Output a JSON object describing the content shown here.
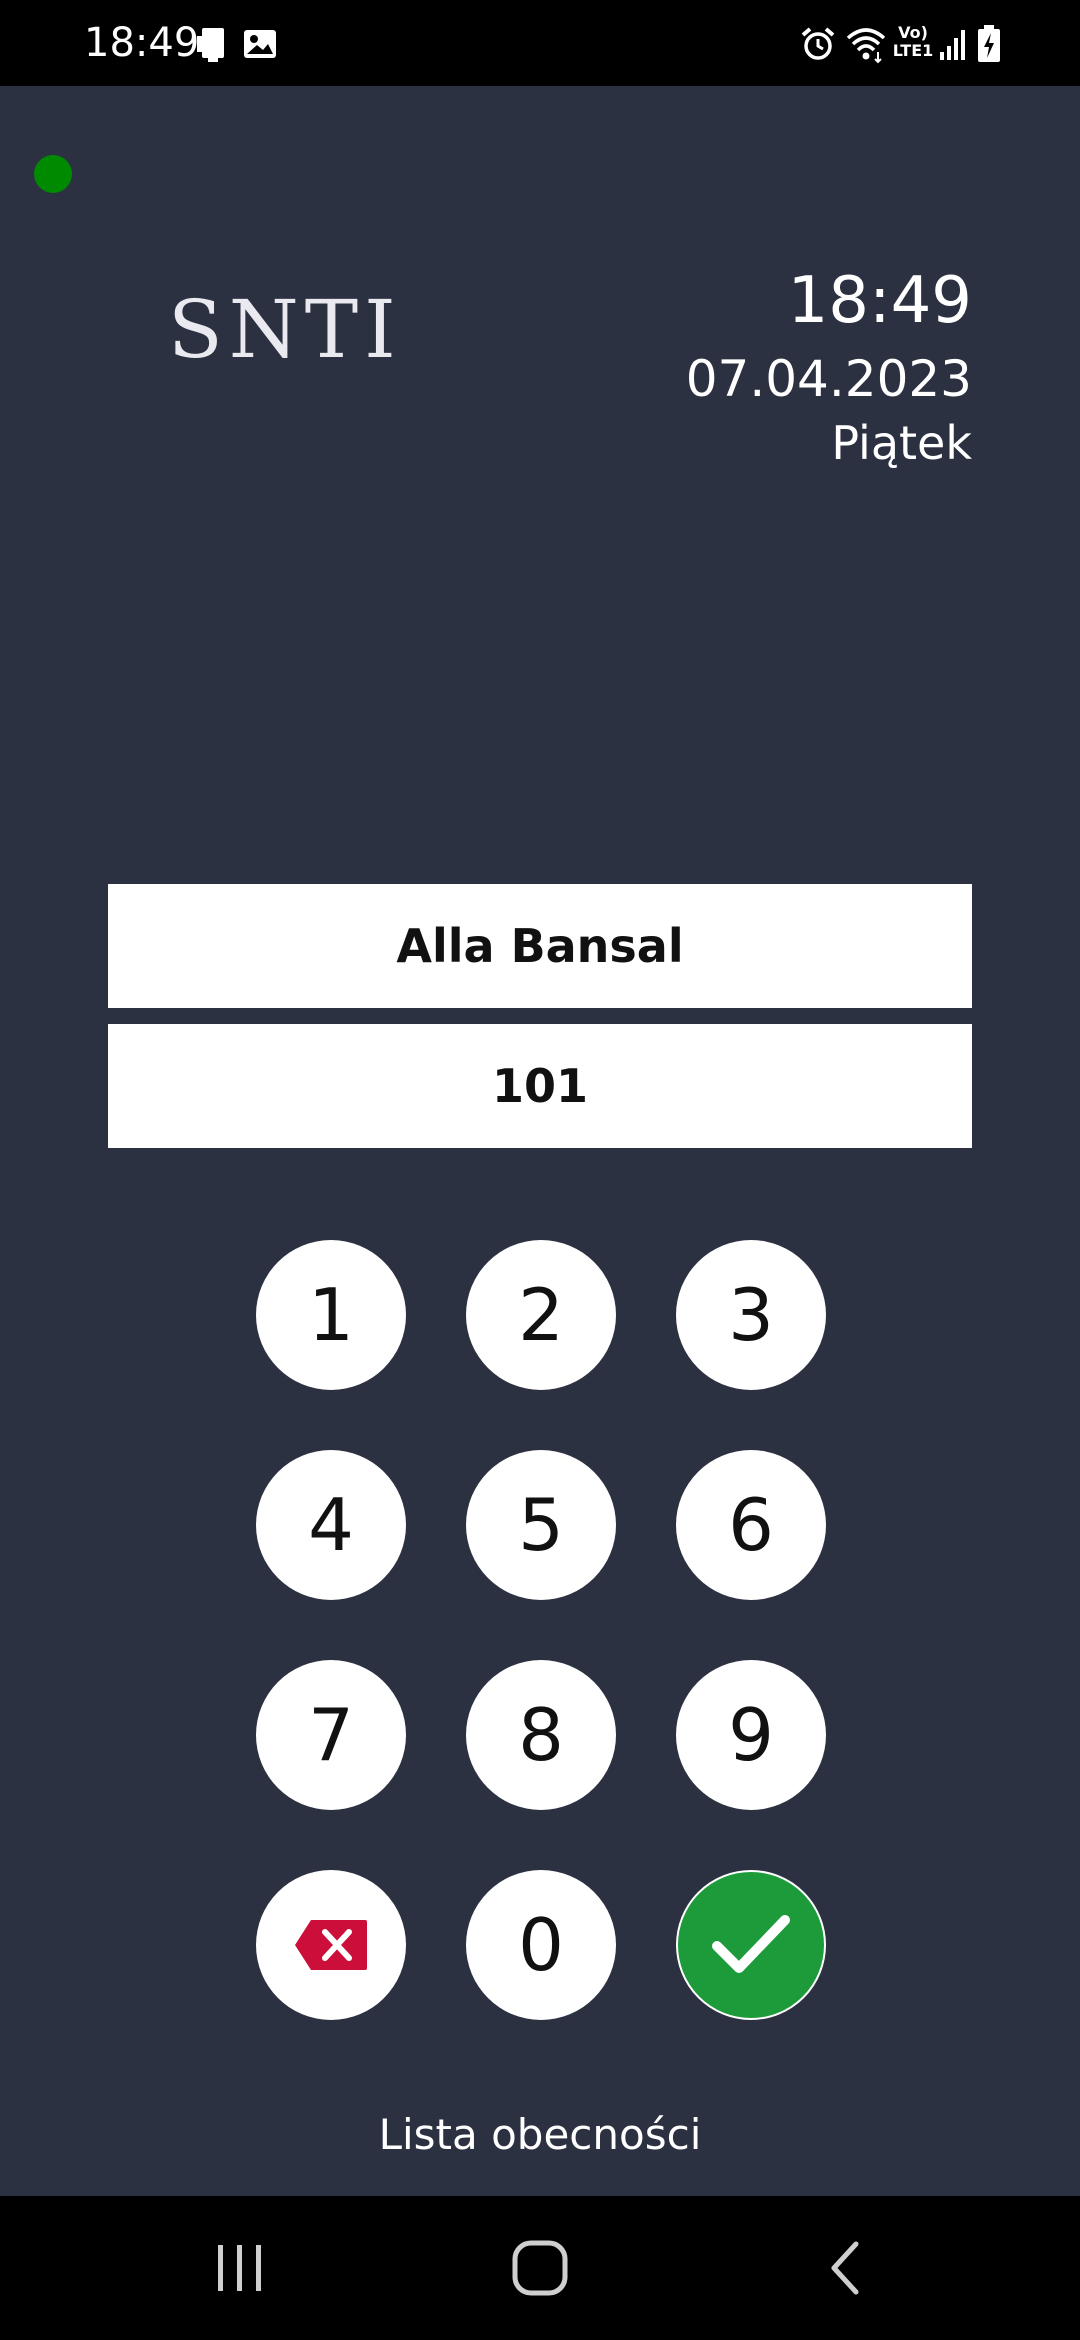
{
  "status_bar": {
    "time": "18:49",
    "left_icons": [
      "nfc-card-icon",
      "image-icon"
    ],
    "right_icons": [
      "alarm-icon",
      "wifi-icon",
      "volte-lte-icon",
      "signal-icon",
      "battery-charging-icon"
    ],
    "network_label_top": "Vo)",
    "network_label_bottom": "LTE1"
  },
  "connection": {
    "status_color": "#008a00"
  },
  "header": {
    "logo_text": "SNTI",
    "time": "18:49",
    "date": "07.04.2023",
    "weekday": "Piątek"
  },
  "employee": {
    "name": "Alla Bansal",
    "code": "101"
  },
  "keypad": {
    "keys": [
      "1",
      "2",
      "3",
      "4",
      "5",
      "6",
      "7",
      "8",
      "9",
      "0"
    ],
    "delete_icon": "backspace-icon",
    "confirm_icon": "checkmark-icon",
    "delete_color": "#cc0f3a",
    "confirm_color": "#1d9a3a"
  },
  "footer": {
    "link_label": "Lista obecności"
  },
  "nav": {
    "icons": [
      "recent-apps-icon",
      "home-icon",
      "back-icon"
    ]
  }
}
